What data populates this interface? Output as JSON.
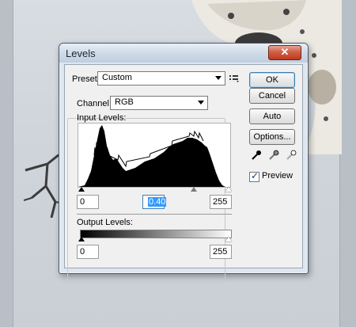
{
  "dialog": {
    "title": "Levels",
    "close_label": "✕",
    "preset": {
      "label": "Preset:",
      "value": "Custom",
      "menu_icon": "presets-menu-icon"
    },
    "channel": {
      "label": "Channel:",
      "value": "RGB"
    },
    "input_levels": {
      "label": "Input Levels:",
      "black": "0",
      "gamma": "0.40",
      "white": "255"
    },
    "output_levels": {
      "label": "Output Levels:",
      "black": "0",
      "white": "255"
    },
    "buttons": {
      "ok": "OK",
      "cancel": "Cancel",
      "auto": "Auto",
      "options": "Options..."
    },
    "preview": {
      "label": "Preview",
      "checked": true
    },
    "eyedroppers": [
      "black-eyedropper-icon",
      "gray-eyedropper-icon",
      "white-eyedropper-icon"
    ]
  },
  "colors": {
    "titlebar": "#cfdbe8",
    "close_button": "#c0391f",
    "selection": "#3399ff",
    "default_button_border": "#3c7fb1"
  }
}
